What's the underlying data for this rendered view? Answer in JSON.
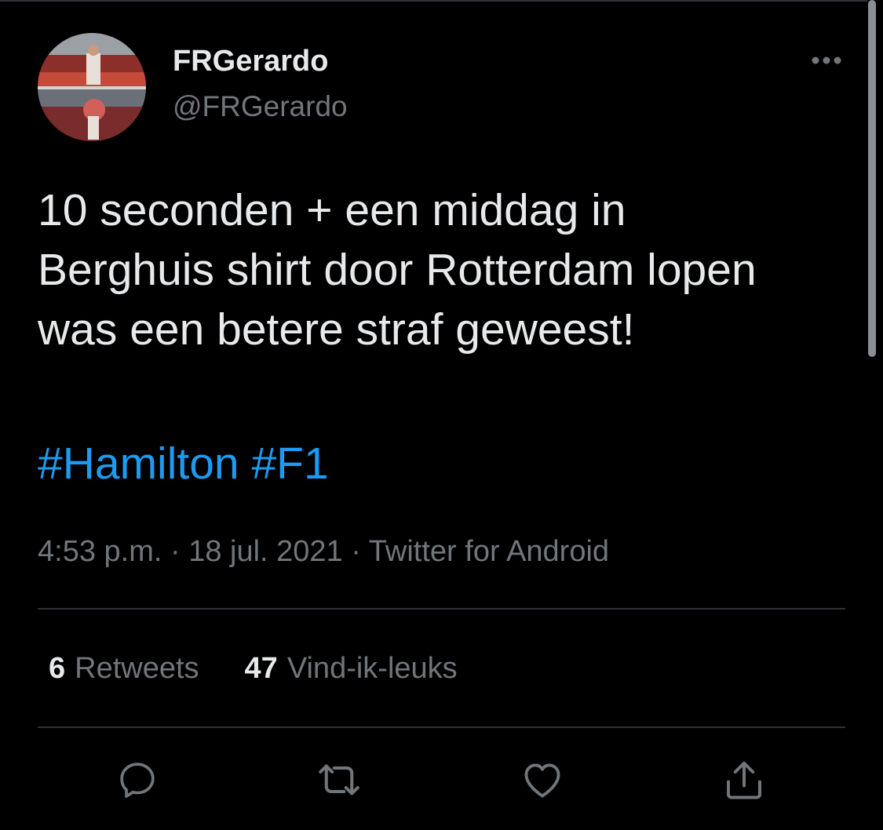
{
  "tweet": {
    "author": {
      "display_name": "FRGerardo",
      "handle": "@FRGerardo",
      "avatar_icon": "profile-photo"
    },
    "text": "10 seconden + een middag in\nBerghuis shirt door Rotterdam lopen\nwas een betere straf geweest!",
    "hashtags": [
      "#Hamilton",
      "#F1"
    ],
    "timestamp": "4:53 p.m.",
    "date": "18 jul. 2021",
    "source": "Twitter for Android",
    "separator": " · ",
    "stats": {
      "retweets_count": "6",
      "retweets_label": "Retweets",
      "likes_count": "47",
      "likes_label": "Vind-ik-leuks"
    }
  },
  "icons": {
    "more": "more-dots-icon",
    "reply": "reply-icon",
    "retweet": "retweet-icon",
    "like": "heart-icon",
    "share": "share-icon"
  },
  "colors": {
    "background": "#000000",
    "text": "#e7e9ea",
    "secondary": "#71767b",
    "link": "#1d9bf0",
    "divider": "#2f3336"
  }
}
